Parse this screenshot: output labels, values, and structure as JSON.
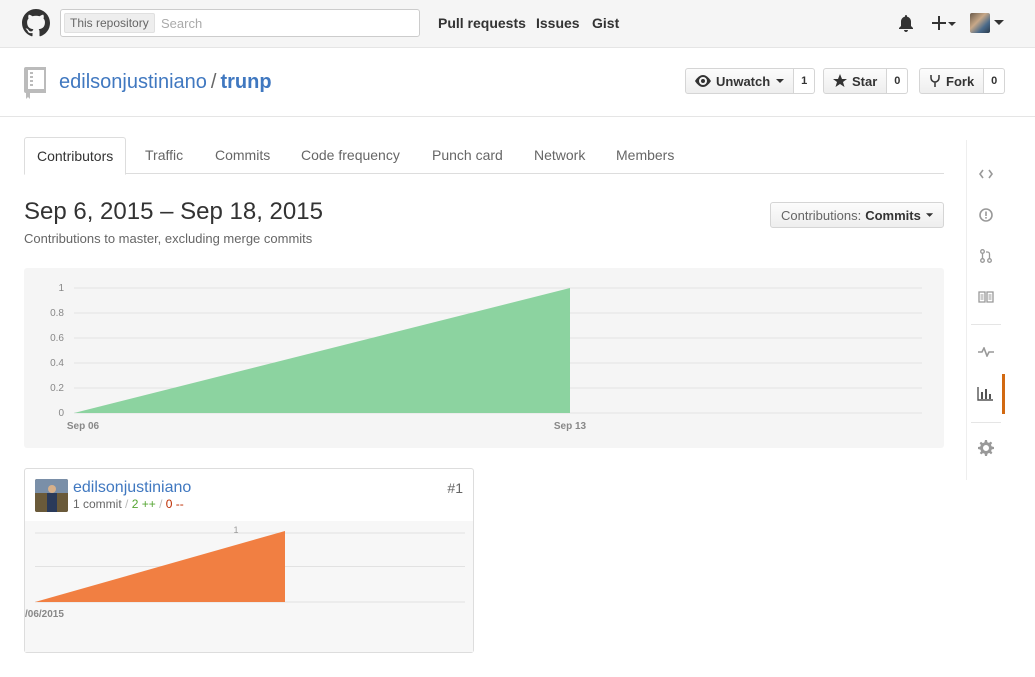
{
  "header": {
    "search_scope": "This repository",
    "search_placeholder": "Search",
    "nav": [
      "Pull requests",
      "Issues",
      "Gist"
    ]
  },
  "repo": {
    "owner": "edilsonjustiniano",
    "separator": "/",
    "name": "trunp",
    "watch_label": "Unwatch",
    "watch_count": "1",
    "star_label": "Star",
    "star_count": "0",
    "fork_label": "Fork",
    "fork_count": "0"
  },
  "tabs": [
    {
      "label": "Contributors",
      "selected": true
    },
    {
      "label": "Traffic"
    },
    {
      "label": "Commits"
    },
    {
      "label": "Code frequency"
    },
    {
      "label": "Punch card"
    },
    {
      "label": "Network"
    },
    {
      "label": "Members"
    }
  ],
  "graph": {
    "date_range": "Sep 6, 2015 – Sep 18, 2015",
    "subtitle": "Contributions to master, excluding merge commits",
    "contrib_label": "Contributions:",
    "contrib_value": "Commits"
  },
  "sidenav": [
    "code-icon",
    "issue-icon",
    "pull-request-icon",
    "wiki-icon",
    "pulse-icon",
    "graph-icon",
    "gear-icon"
  ],
  "contributor": {
    "username": "edilsonjustiniano",
    "commits": "1 commit",
    "additions": "2 ++",
    "deletions": "0 --",
    "slash": "/",
    "rank": "#1"
  },
  "chart_data": [
    {
      "type": "area",
      "x": [
        "Sep 06",
        "Sep 13"
      ],
      "values": [
        0,
        1
      ],
      "ylim": [
        0,
        1
      ],
      "yticks": [
        "0",
        "0.2",
        "0.4",
        "0.6",
        "0.8",
        "1"
      ],
      "xticks": [
        "Sep 06",
        "Sep 13"
      ],
      "color": "#8cd3a0",
      "grid": true
    },
    {
      "type": "area",
      "x": [
        "/06/2015",
        ""
      ],
      "values": [
        0,
        1
      ],
      "ylim": [
        0,
        1
      ],
      "yticks": [
        "1"
      ],
      "xticks": [
        "/06/2015"
      ],
      "color": "#f17f42",
      "grid": true
    }
  ]
}
